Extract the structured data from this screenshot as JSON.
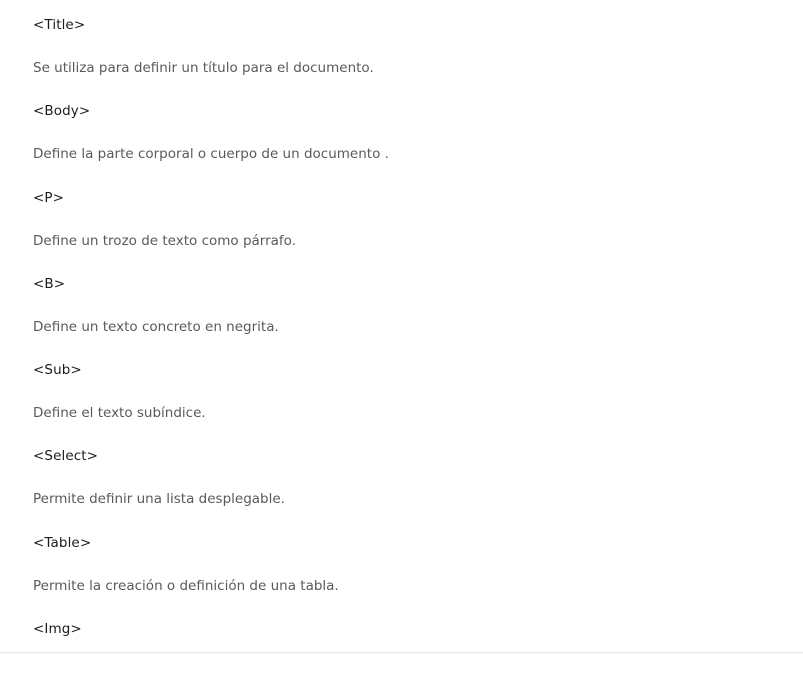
{
  "entries": [
    {
      "tag": "<Title>",
      "description": "Se utiliza para definir un título para el documento."
    },
    {
      "tag": "<Body>",
      "description": "Define la parte corporal o cuerpo de un documento ."
    },
    {
      "tag": "<P>",
      "description": "Define un trozo de texto como párrafo."
    },
    {
      "tag": "<B>",
      "description": "Define un texto concreto en negrita."
    },
    {
      "tag": "<Sub>",
      "description": "Define el texto subíndice."
    },
    {
      "tag": "<Select>",
      "description": "Permite definir una lista desplegable."
    },
    {
      "tag": "<Table>",
      "description": "Permite la creación o definición de una tabla."
    },
    {
      "tag": "<Img>",
      "description": ""
    }
  ]
}
